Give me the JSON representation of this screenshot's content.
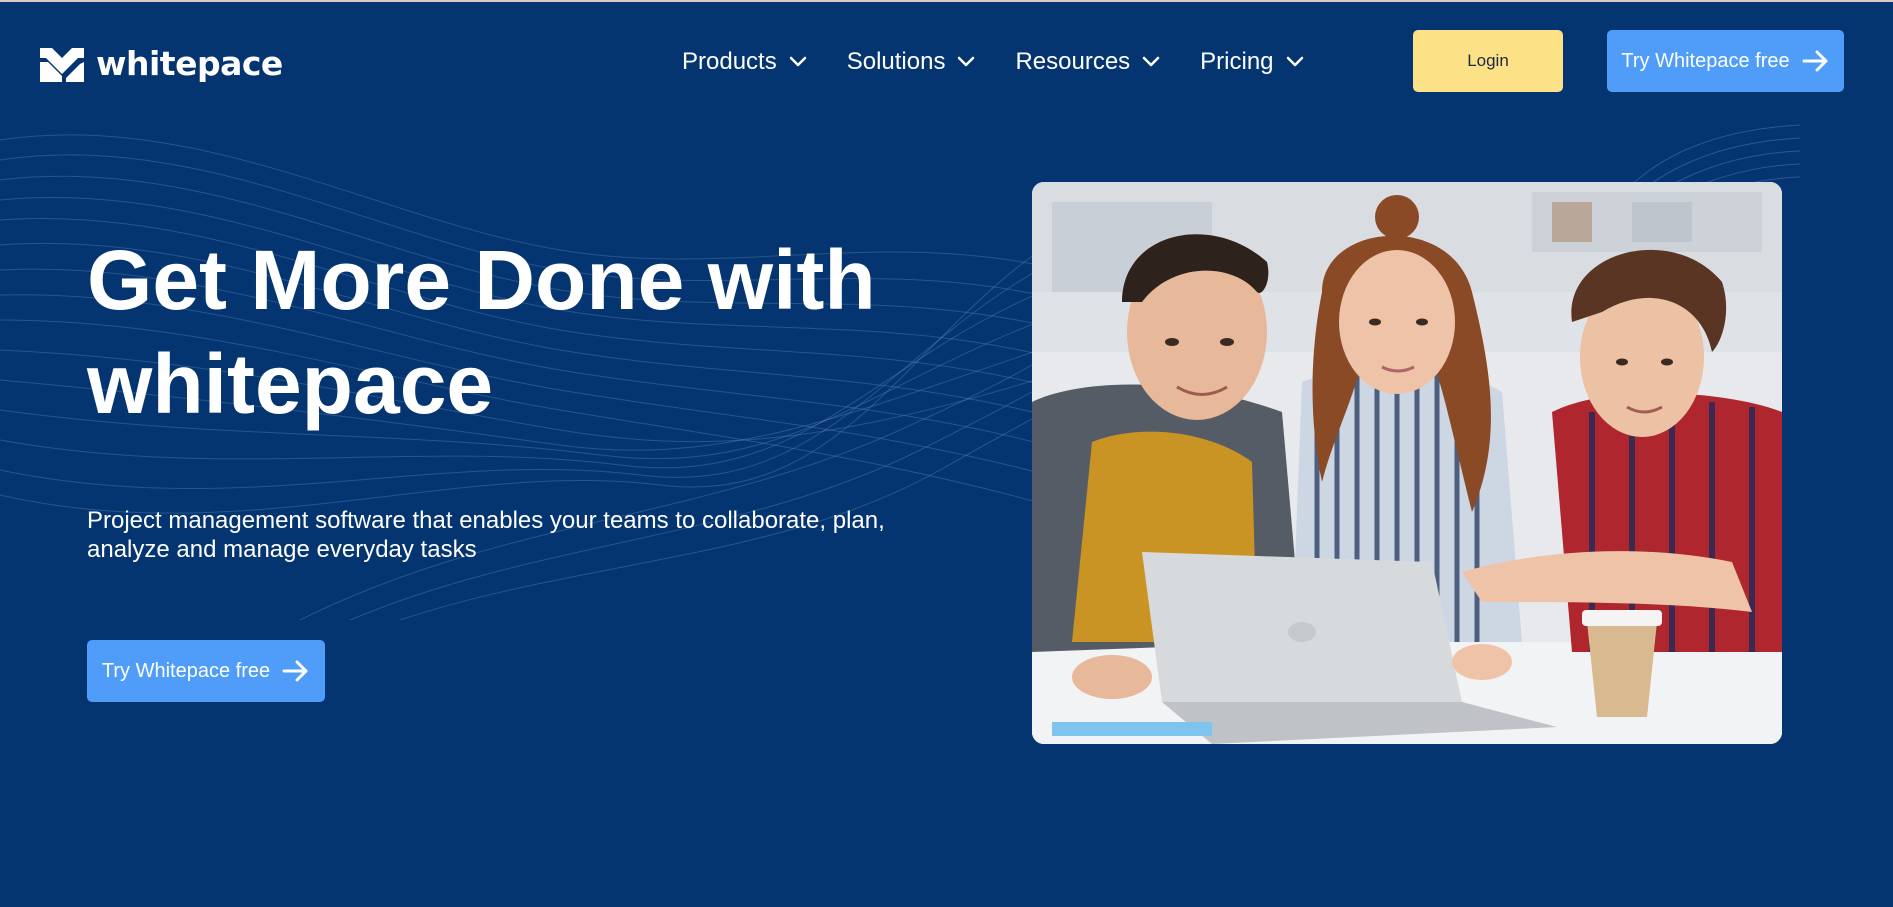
{
  "brand": {
    "name": "whitepace",
    "logo_icon": "whitepace-logo-icon",
    "colors": {
      "background": "#043570",
      "primary_button": "#4f9cf9",
      "login_button": "#fde187",
      "text": "#ffffff"
    }
  },
  "nav": {
    "items": [
      {
        "label": "Products",
        "icon": "chevron-down-icon"
      },
      {
        "label": "Solutions",
        "icon": "chevron-down-icon"
      },
      {
        "label": "Resources",
        "icon": "chevron-down-icon"
      },
      {
        "label": "Pricing",
        "icon": "chevron-down-icon"
      }
    ],
    "login_label": "Login",
    "cta_label": "Try Whitepace free",
    "cta_icon": "arrow-right-icon"
  },
  "hero": {
    "title_line1": "Get More Done with",
    "title_line2": "whitepace",
    "subtitle_line1": "Project management software that enables your teams to collaborate, plan,",
    "subtitle_line2": "analyze and manage everyday tasks",
    "cta_label": "Try Whitepace free",
    "cta_icon": "arrow-right-icon",
    "image_alt": "three-people-looking-at-laptop-photo"
  }
}
